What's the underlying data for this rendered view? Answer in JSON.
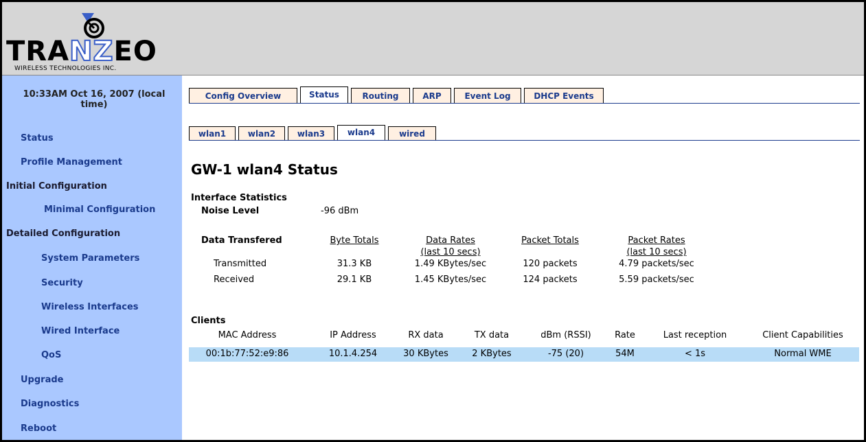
{
  "header": {
    "logo_text_1": "TRA",
    "logo_text_nz": "NZ",
    "logo_text_2": "EO",
    "tagline": "WIRELESS TECHNOLOGIES INC."
  },
  "sidebar": {
    "clock": "10:33AM Oct 16, 2007 (local time)",
    "items": [
      {
        "label": "Status"
      },
      {
        "label": "Profile Management"
      },
      {
        "label": "Initial Configuration"
      },
      {
        "label": "Minimal Configuration"
      },
      {
        "label": "Detailed Configuration"
      },
      {
        "label": "System Parameters"
      },
      {
        "label": "Security"
      },
      {
        "label": "Wireless Interfaces"
      },
      {
        "label": "Wired Interface"
      },
      {
        "label": "QoS"
      },
      {
        "label": "Upgrade"
      },
      {
        "label": "Diagnostics"
      },
      {
        "label": "Reboot"
      }
    ]
  },
  "tabs": [
    "Config Overview",
    "Status",
    "Routing",
    "ARP",
    "Event Log",
    "DHCP Events"
  ],
  "active_tab": "Status",
  "subtabs": [
    "wlan1",
    "wlan2",
    "wlan3",
    "wlan4",
    "wired"
  ],
  "active_subtab": "wlan4",
  "page_title": "GW-1 wlan4 Status",
  "interface_stats": {
    "heading": "Interface Statistics",
    "noise_label": "Noise Level",
    "noise_value": "-96 dBm",
    "data_transfered_label": "Data Transfered",
    "columns": {
      "byte_totals": "Byte Totals",
      "data_rates_1": "Data Rates",
      "data_rates_2": "(last 10 secs)",
      "packet_totals": "Packet Totals",
      "packet_rates_1": "Packet Rates",
      "packet_rates_2": "(last 10 secs)"
    },
    "rows": [
      {
        "label": "Transmitted",
        "bytes": "31.3 KB",
        "rate": "1.49 KBytes/sec",
        "packets": "120 packets",
        "prate": "4.79 packets/sec"
      },
      {
        "label": "Received",
        "bytes": "29.1 KB",
        "rate": "1.45 KBytes/sec",
        "packets": "124 packets",
        "prate": "5.59 packets/sec"
      }
    ]
  },
  "clients": {
    "heading": "Clients",
    "headers": [
      "MAC Address",
      "IP Address",
      "RX data",
      "TX data",
      "dBm (RSSI)",
      "Rate",
      "Last reception",
      "Client Capabilities"
    ],
    "rows": [
      [
        "00:1b:77:52:e9:86",
        "10.1.4.254",
        "30 KBytes",
        "2 KBytes",
        "-75 (20)",
        "54M",
        "< 1s",
        "Normal WME"
      ]
    ]
  },
  "colors": {
    "sidebar_bg": "#aac8ff",
    "header_bg": "#d6d6d6",
    "link": "#1a3a8c",
    "tab_bg": "#fff0e2",
    "client_row_bg": "#b8dcf7"
  }
}
